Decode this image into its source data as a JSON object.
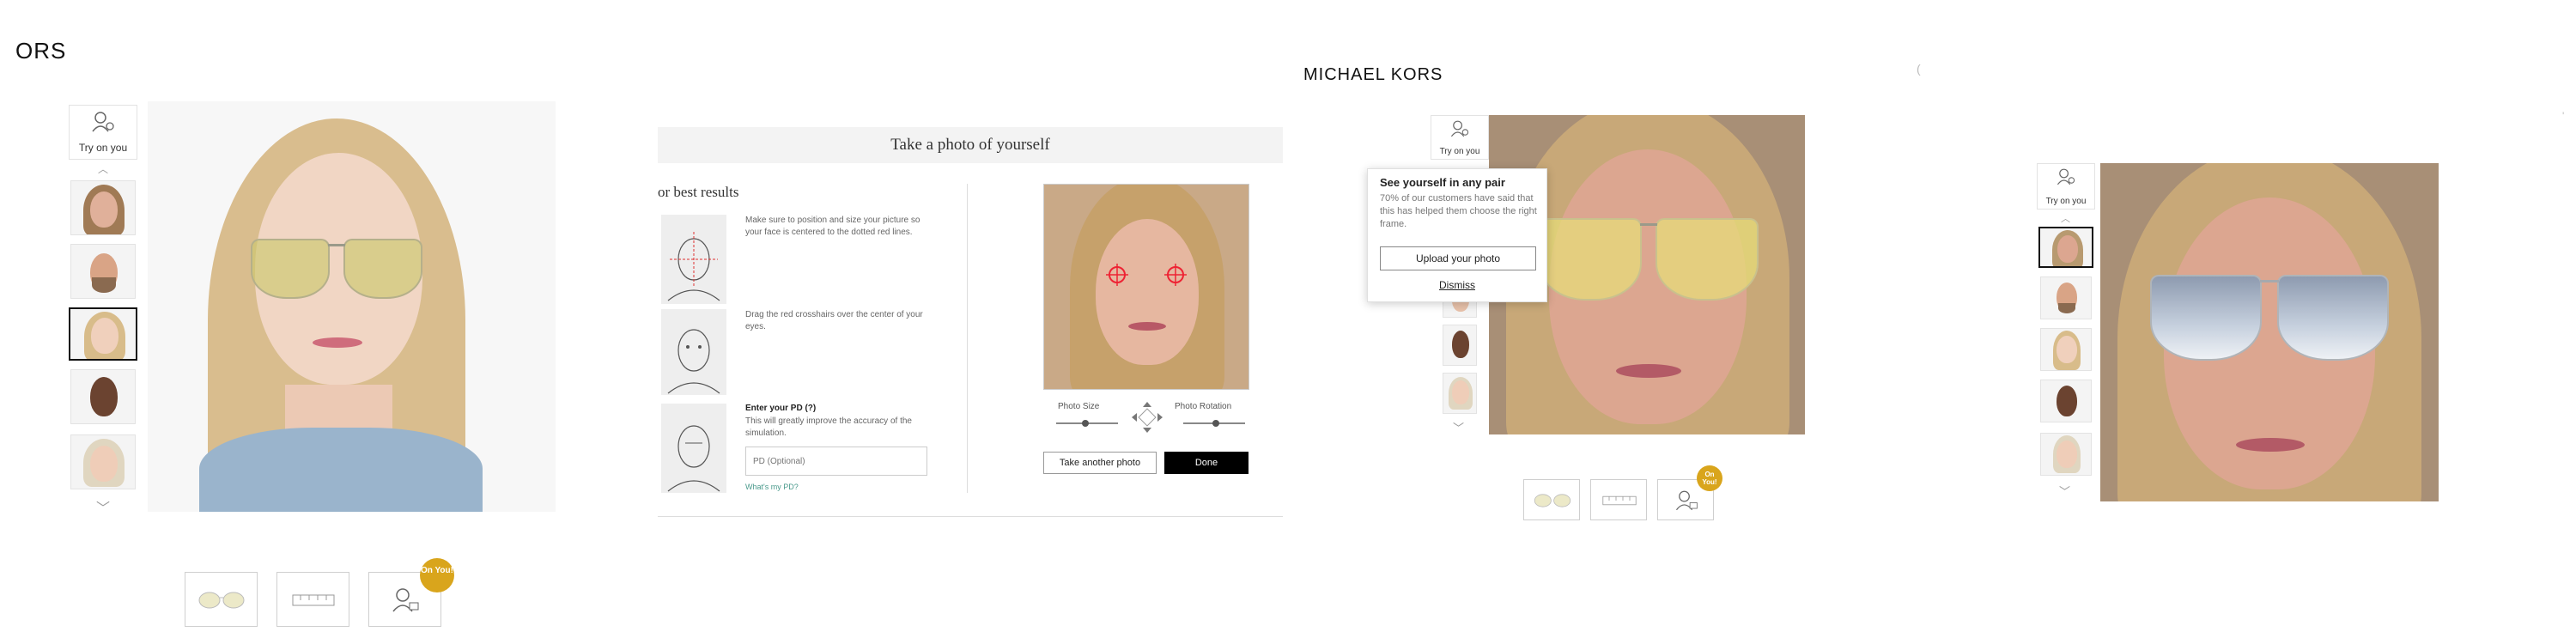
{
  "panel1": {
    "brand": "ORS",
    "try_on_label": "Try on you",
    "badge": "On You!"
  },
  "panel2": {
    "dialog_title": "Take a photo of yourself",
    "tips_heading": "or best results",
    "tip1": "Make sure to position and size your picture so your face is centered to the dotted red lines.",
    "tip2": "Drag the red crosshairs over the center of your eyes.",
    "pd_label": "Enter your PD (?)",
    "pd_desc": "This will greatly improve the accuracy of the simulation.",
    "pd_placeholder": "PD (Optional)",
    "pd_link": "What's my PD?",
    "photo_size_label": "Photo Size",
    "photo_rotation_label": "Photo Rotation",
    "take_another_label": "Take another photo",
    "done_label": "Done"
  },
  "panel3": {
    "brand": "MICHAEL KORS",
    "try_on_label": "Try on you",
    "popup_title": "See yourself in any pair",
    "popup_text": "70% of our customers have said that this has helped them choose the right frame.",
    "upload_label": "Upload your photo",
    "dismiss_label": "Dismiss",
    "badge": "On You!"
  },
  "panel4": {
    "try_on_label": "Try on you"
  },
  "colors": {
    "badge": "#d9a51c",
    "tint_lens": "#d8d68a",
    "mirror_lens": "#aab7c8",
    "link": "#4a9a8c"
  }
}
